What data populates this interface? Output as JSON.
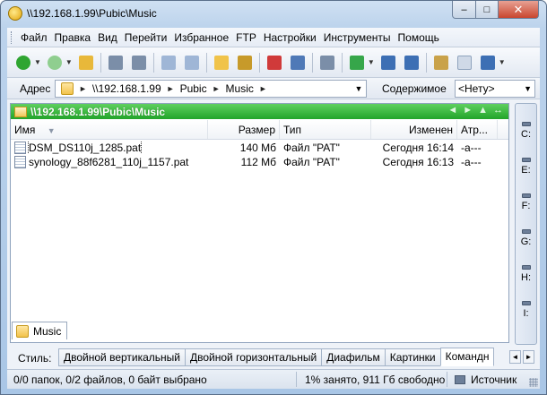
{
  "window": {
    "title": "\\\\192.168.1.99\\Pubic\\Music",
    "controls": {
      "minimize": "–",
      "maximize": "□",
      "close": "✕"
    }
  },
  "menu": {
    "items": [
      "Файл",
      "Правка",
      "Вид",
      "Перейти",
      "Избранное",
      "FTP",
      "Настройки",
      "Инструменты",
      "Помощь"
    ]
  },
  "toolbar": {
    "buttons": [
      {
        "name": "back-icon",
        "color": "#2fa531"
      },
      {
        "name": "forward-icon",
        "color": "#8fce8f"
      },
      {
        "name": "up-folder-icon",
        "color": "#e8b83a"
      },
      {
        "name": "select-icon",
        "color": "#7b8ea8"
      },
      {
        "name": "invert-select-icon",
        "color": "#7b8ea8"
      },
      {
        "name": "copy-icon",
        "color": "#9fb6d6"
      },
      {
        "name": "paste-icon",
        "color": "#9fb6d6"
      },
      {
        "name": "new-folder-icon",
        "color": "#f0c34a"
      },
      {
        "name": "rename-icon",
        "color": "#c79a2a"
      },
      {
        "name": "delete-icon",
        "color": "#d03a3a"
      },
      {
        "name": "undo-icon",
        "color": "#4f79b7"
      },
      {
        "name": "find-icon",
        "color": "#7b8ea8"
      },
      {
        "name": "copy-to-icon",
        "color": "#36a64a"
      },
      {
        "name": "dual-pane-icon",
        "color": "#3d6fb4"
      },
      {
        "name": "horizontal-pane-icon",
        "color": "#3d6fb4"
      },
      {
        "name": "properties-icon",
        "color": "#c9a24a"
      },
      {
        "name": "new-file-icon",
        "color": "#cfd9e7"
      },
      {
        "name": "edit-icon",
        "color": "#3d6fb4"
      }
    ]
  },
  "address": {
    "label": "Адрес",
    "crumbs": [
      "\\\\192.168.1.99",
      "Pubic",
      "Music"
    ],
    "content_label": "Содержимое",
    "content_value": "<Нету>"
  },
  "panel": {
    "path": "\\\\192.168.1.99\\Pubic\\Music",
    "nav": [
      "◄",
      "►",
      "▲",
      "↔"
    ],
    "columns": {
      "name": "Имя",
      "size": "Размер",
      "type": "Тип",
      "modified": "Изменен",
      "attr": "Атр..."
    },
    "files": [
      {
        "name": "DSM_DS110j_1285.pat",
        "size": "140 Мб",
        "type": "Файл \"PAT\"",
        "modified": "Сегодня 16:14",
        "attr": "-a---"
      },
      {
        "name": "synology_88f6281_110j_1157.pat",
        "size": "112 Мб",
        "type": "Файл \"PAT\"",
        "modified": "Сегодня 16:13",
        "attr": "-a---"
      }
    ],
    "tab": "Music"
  },
  "drives": [
    "C:",
    "E:",
    "F:",
    "G:",
    "H:",
    "I:"
  ],
  "styles": {
    "label": "Стиль:",
    "tabs": [
      "Двойной вертикальный",
      "Двойной горизонтальный",
      "Диафильм",
      "Картинки",
      "Командн"
    ],
    "active_index": 4
  },
  "status": {
    "selection": "0/0 папок, 0/2 файлов, 0 байт выбрано",
    "space": "1% занято, 911 Гб свободно",
    "source": "Источник"
  }
}
